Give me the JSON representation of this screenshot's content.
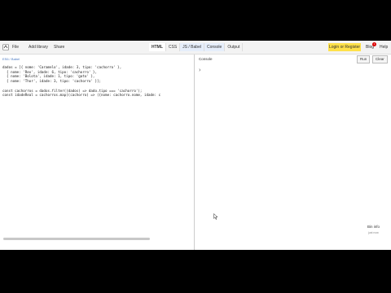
{
  "toolbar": {
    "file": "File",
    "add_library": "Add library",
    "share": "Share",
    "tabs": [
      {
        "label": "HTML",
        "active": true
      },
      {
        "label": "CSS",
        "active": false
      },
      {
        "label": "JS / Babel",
        "active": false
      },
      {
        "label": "Console",
        "active": false
      },
      {
        "label": "Output",
        "active": false
      }
    ],
    "login": "Login or Register",
    "blog": "Blog",
    "blog_badge": "1",
    "help": "Help"
  },
  "editor": {
    "breadcrumb": "ES6 / Babel",
    "code_lines": [
      "dados = [{ nome: 'Caramelo', idade: 3, tipo: 'cachorro' },",
      "  { nome: 'Rex', idade: 6, tipo: 'cachorro' },",
      "  { nome: 'Bolota', idade: 1, tipo: 'gato' },",
      "  { nome: 'Thor', idade: 3, tipo: 'cachorro' }];",
      "",
      "const cachorros = dados.filter((dados) => dado.tipo === 'cachorro');",
      "const idadeReal = cachorros.map((cachorro) => ({nome: cachorro.nome, idade: c"
    ]
  },
  "console": {
    "title": "Console",
    "run": "Run",
    "clear": "Clear",
    "prompt": "❯",
    "bin_info": "Bin info",
    "bin_sub": "just now"
  },
  "colors": {
    "login_bg": "#ffe14a",
    "badge": "#dd0000",
    "link": "#4a78c2"
  }
}
